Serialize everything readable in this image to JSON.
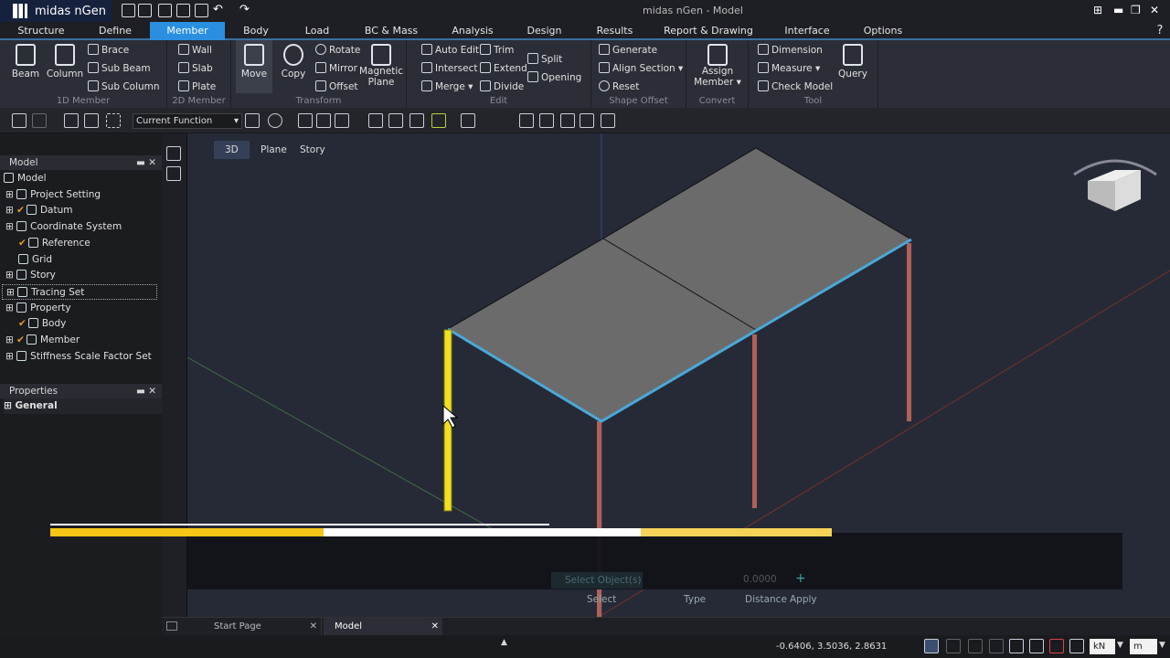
{
  "app": {
    "name": "midas nGen",
    "window_title": "midas nGen - Model"
  },
  "tabs": [
    "Structure",
    "Define",
    "Member",
    "Body",
    "Load",
    "BC & Mass",
    "Analysis",
    "Design",
    "Results",
    "Report & Drawing",
    "Interface",
    "Options"
  ],
  "active_tab": "Member",
  "ribbon": {
    "member1d": {
      "label": "1D Member",
      "beam": "Beam",
      "column": "Column",
      "brace": "Brace",
      "sub_beam": "Sub Beam",
      "sub_column": "Sub Column"
    },
    "member2d": {
      "label": "2D Member",
      "wall": "Wall",
      "slab": "Slab",
      "plate": "Plate"
    },
    "transform": {
      "label": "Transform",
      "move": "Move",
      "copy": "Copy",
      "rotate": "Rotate",
      "mirror": "Mirror",
      "offset": "Offset",
      "magnetic": "Magnetic",
      "plane": "Plane"
    },
    "edit": {
      "label": "Edit",
      "auto_edit": "Auto Edit",
      "intersect": "Intersect",
      "merge": "Merge",
      "trim": "Trim",
      "extend": "Extend",
      "divide": "Divide",
      "split": "Split",
      "opening": "Opening"
    },
    "shape_offset": {
      "label": "Shape Offset",
      "generate": "Generate",
      "align_section": "Align Section",
      "reset": "Reset"
    },
    "convert": {
      "label": "Convert",
      "assign": "Assign",
      "member": "Member"
    },
    "tool": {
      "label": "Tool",
      "dimension": "Dimension",
      "measure": "Measure",
      "check_model": "Check Model",
      "query": "Query"
    }
  },
  "toolbar": {
    "function_select": "Current Function"
  },
  "model_panel": {
    "title": "Model",
    "items": [
      {
        "label": "Model",
        "level": 0
      },
      {
        "label": "Project Setting",
        "level": 1
      },
      {
        "label": "Datum",
        "level": 1,
        "checked": true
      },
      {
        "label": "Coordinate System",
        "level": 1
      },
      {
        "label": "Reference",
        "level": 2,
        "checked": true
      },
      {
        "label": "Grid",
        "level": 2
      },
      {
        "label": "Story",
        "level": 1
      },
      {
        "label": "Tracing Set",
        "level": 1,
        "selected": true
      },
      {
        "label": "Property",
        "level": 1
      },
      {
        "label": "Body",
        "level": 2,
        "checked": true
      },
      {
        "label": "Member",
        "level": 1,
        "checked": true
      },
      {
        "label": "Stiffness Scale Factor Set",
        "level": 1
      }
    ]
  },
  "properties_panel": {
    "title": "Properties",
    "section": "General"
  },
  "view_tabs": [
    "3D",
    "Plane",
    "Story"
  ],
  "command_bar": {
    "select_placeholder": "Select Object(s)",
    "distance": "0.0000",
    "labels": [
      "Select",
      "Type",
      "Distance",
      "Apply"
    ]
  },
  "progress": {
    "segments": [
      {
        "color": "#f5c518",
        "fraction": 0.35
      },
      {
        "color": "#ffffff",
        "fraction": 0.405
      },
      {
        "color": "#f5d358",
        "fraction": 0.245
      }
    ]
  },
  "doc_tabs": [
    "Start Page",
    "Model"
  ],
  "status": {
    "coordinates": "-0.6406, 3.5036, 2.8631",
    "force_unit": "kN",
    "length_unit": "m"
  },
  "colors": {
    "accent": "#2a8fe0",
    "selected_member": "#f0e020",
    "slab": "#6b6b6b",
    "column": "#c26b5e"
  }
}
